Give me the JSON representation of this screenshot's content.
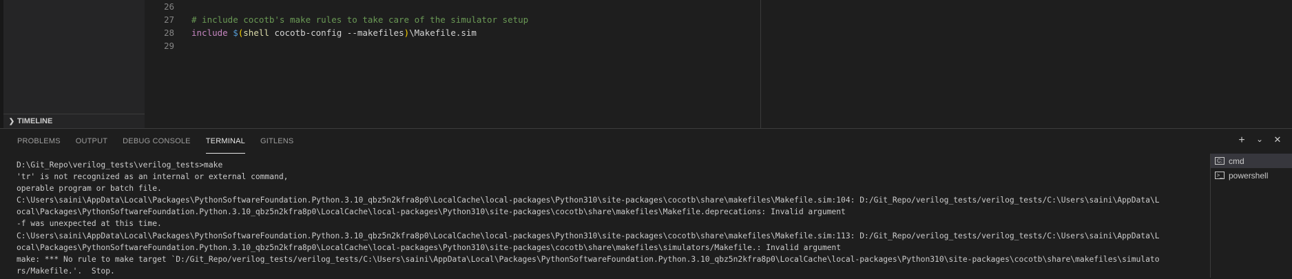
{
  "sidebar": {
    "timeline_label": "TIMELINE"
  },
  "editor": {
    "lines": [
      {
        "num": "26",
        "text": ""
      },
      {
        "num": "27",
        "comment": "# include cocotb's make rules to take care of the simulator setup"
      },
      {
        "num": "28",
        "keyword": "include",
        "dollar": "$",
        "open": "(",
        "fn": "shell",
        "args": " cocotb-config --makefiles",
        "close": ")",
        "rest": "\\Makefile.sim"
      },
      {
        "num": "29",
        "text": ""
      }
    ]
  },
  "panel": {
    "tabs": [
      "PROBLEMS",
      "OUTPUT",
      "DEBUG CONSOLE",
      "TERMINAL",
      "GITLENS"
    ],
    "active_tab": "TERMINAL",
    "actions": {
      "new": "+",
      "dropdown": "⌄",
      "close": "✕"
    },
    "terminal_lines": [
      "D:\\Git_Repo\\verilog_tests\\verilog_tests>make",
      "'tr' is not recognized as an internal or external command,",
      "operable program or batch file.",
      "C:\\Users\\saini\\AppData\\Local\\Packages\\PythonSoftwareFoundation.Python.3.10_qbz5n2kfra8p0\\LocalCache\\local-packages\\Python310\\site-packages\\cocotb\\share\\makefiles\\Makefile.sim:104: D:/Git_Repo/verilog_tests/verilog_tests/C:\\Users\\saini\\AppData\\L",
      "ocal\\Packages\\PythonSoftwareFoundation.Python.3.10_qbz5n2kfra8p0\\LocalCache\\local-packages\\Python310\\site-packages\\cocotb\\share\\makefiles\\Makefile.deprecations: Invalid argument",
      "-f was unexpected at this time.",
      "C:\\Users\\saini\\AppData\\Local\\Packages\\PythonSoftwareFoundation.Python.3.10_qbz5n2kfra8p0\\LocalCache\\local-packages\\Python310\\site-packages\\cocotb\\share\\makefiles\\Makefile.sim:113: D:/Git_Repo/verilog_tests/verilog_tests/C:\\Users\\saini\\AppData\\L",
      "ocal\\Packages\\PythonSoftwareFoundation.Python.3.10_qbz5n2kfra8p0\\LocalCache\\local-packages\\Python310\\site-packages\\cocotb\\share\\makefiles\\simulators/Makefile.: Invalid argument",
      "make: *** No rule to make target `D:/Git_Repo/verilog_tests/verilog_tests/C:\\Users\\saini\\AppData\\Local\\Packages\\PythonSoftwareFoundation.Python.3.10_qbz5n2kfra8p0\\LocalCache\\local-packages\\Python310\\site-packages\\cocotb\\share\\makefiles\\simulato",
      "rs/Makefile.'.  Stop."
    ],
    "terminal_list": [
      {
        "name": "cmd",
        "icon": "cmd-icon",
        "selected": true
      },
      {
        "name": "powershell",
        "icon": "powershell-icon",
        "selected": false
      }
    ]
  }
}
